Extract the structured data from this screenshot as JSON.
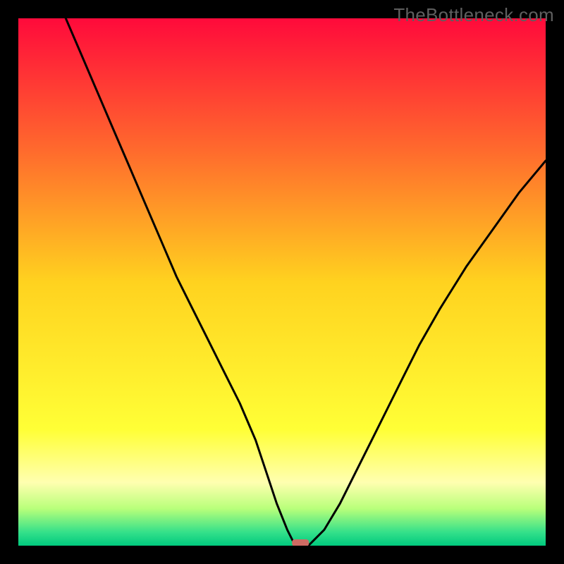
{
  "watermark": "TheBottleneck.com",
  "chart_data": {
    "type": "line",
    "title": "",
    "xlabel": "",
    "ylabel": "",
    "xlim": [
      0,
      100
    ],
    "ylim": [
      0,
      100
    ],
    "x": [
      9,
      12,
      15,
      18,
      21,
      24,
      27,
      30,
      33,
      36,
      39,
      42,
      45,
      47,
      49,
      51,
      52,
      53,
      55,
      58,
      61,
      64,
      67,
      70,
      73,
      76,
      80,
      85,
      90,
      95,
      100
    ],
    "y": [
      100,
      93,
      86,
      79,
      72,
      65,
      58,
      51,
      45,
      39,
      33,
      27,
      20,
      14,
      8,
      3,
      1,
      0,
      0,
      3,
      8,
      14,
      20,
      26,
      32,
      38,
      45,
      53,
      60,
      67,
      73
    ],
    "marker": {
      "x": 53.5,
      "y": 0
    },
    "background_gradient": {
      "stops": [
        {
          "offset": 0.0,
          "color": "#ff0a3b"
        },
        {
          "offset": 0.25,
          "color": "#ff6a2d"
        },
        {
          "offset": 0.5,
          "color": "#ffd21f"
        },
        {
          "offset": 0.78,
          "color": "#ffff36"
        },
        {
          "offset": 0.88,
          "color": "#ffffb0"
        },
        {
          "offset": 0.93,
          "color": "#b8ff7a"
        },
        {
          "offset": 0.975,
          "color": "#33e08a"
        },
        {
          "offset": 1.0,
          "color": "#00c97e"
        }
      ]
    }
  }
}
